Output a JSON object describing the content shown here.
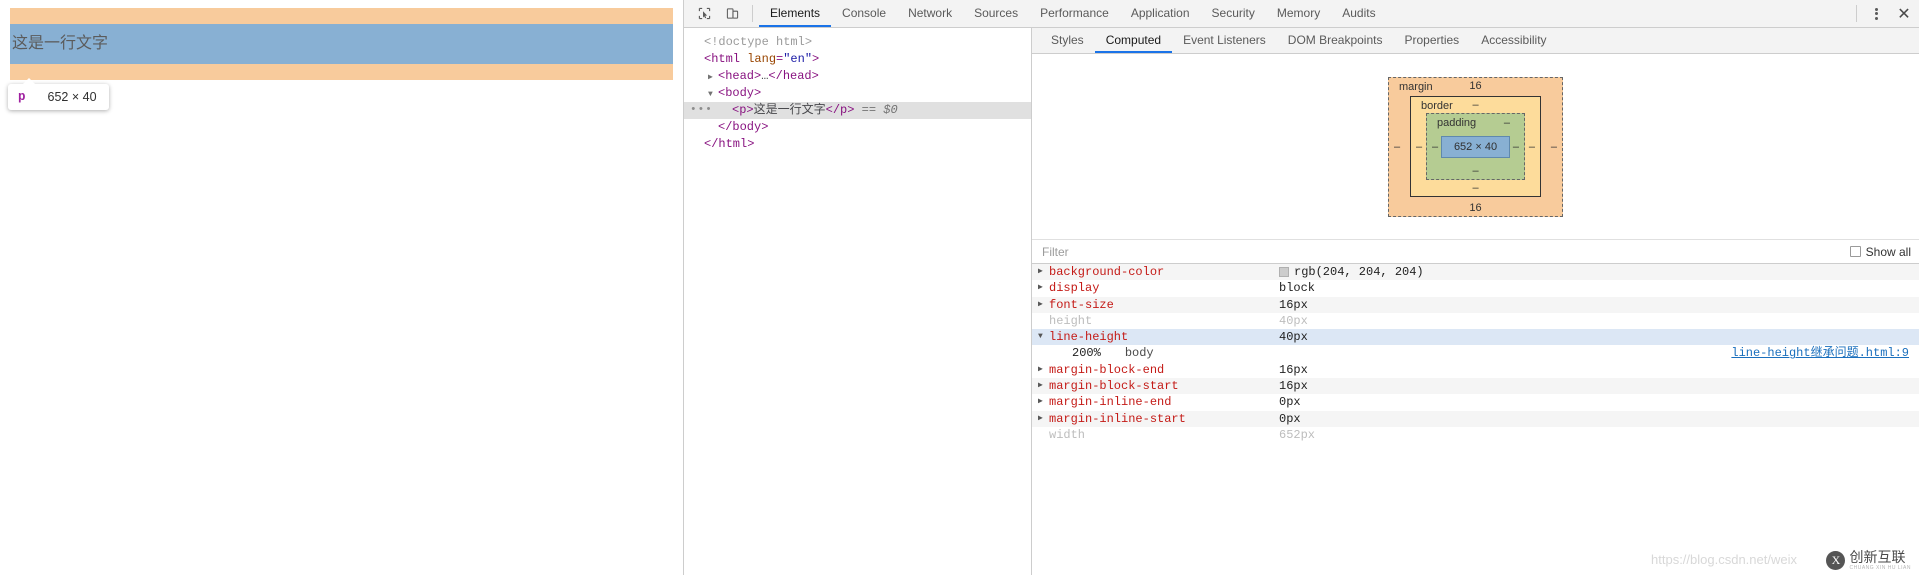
{
  "webpage": {
    "paragraph_text": "这是一行文字",
    "inspect_tooltip": {
      "tag": "p",
      "dimensions": "652 × 40"
    }
  },
  "devtools": {
    "toolbar": {
      "inspect_icon": "cursor-select-icon",
      "device_icon": "device-toolbar-icon",
      "tabs": [
        {
          "label": "Elements",
          "active": true
        },
        {
          "label": "Console",
          "active": false
        },
        {
          "label": "Network",
          "active": false
        },
        {
          "label": "Sources",
          "active": false
        },
        {
          "label": "Performance",
          "active": false
        },
        {
          "label": "Application",
          "active": false
        },
        {
          "label": "Security",
          "active": false
        },
        {
          "label": "Memory",
          "active": false
        },
        {
          "label": "Audits",
          "active": false
        }
      ],
      "more_icon": "kebab-menu-icon",
      "close_icon": "close-icon",
      "close_label": "✕"
    },
    "dom_tree": [
      {
        "indent": 0,
        "twisty": "",
        "badge": false,
        "selected": false,
        "parts": [
          {
            "cls": "dt-doctype",
            "t": "<!doctype html>"
          }
        ]
      },
      {
        "indent": 0,
        "twisty": "",
        "badge": false,
        "selected": false,
        "parts": [
          {
            "cls": "tw",
            "t": "<html "
          },
          {
            "cls": "at",
            "t": "lang"
          },
          {
            "cls": "tw",
            "t": "="
          },
          {
            "cls": "av",
            "t": "\"en\""
          },
          {
            "cls": "tw",
            "t": ">"
          }
        ]
      },
      {
        "indent": 1,
        "twisty": "▶",
        "badge": false,
        "selected": false,
        "parts": [
          {
            "cls": "tw",
            "t": "<head>"
          },
          {
            "cls": "txt",
            "t": "…"
          },
          {
            "cls": "tw",
            "t": "</head>"
          }
        ]
      },
      {
        "indent": 1,
        "twisty": "▼",
        "badge": false,
        "selected": false,
        "parts": [
          {
            "cls": "tw",
            "t": "<body>"
          }
        ]
      },
      {
        "indent": 2,
        "twisty": "",
        "badge": true,
        "selected": true,
        "parts": [
          {
            "cls": "tw",
            "t": "<p>"
          },
          {
            "cls": "txt",
            "t": "这是一行文字"
          },
          {
            "cls": "tw",
            "t": "</p>"
          },
          {
            "cls": "dollar",
            "t": " == $0"
          }
        ]
      },
      {
        "indent": 1,
        "twisty": "",
        "badge": false,
        "selected": false,
        "parts": [
          {
            "cls": "tw",
            "t": "</body>"
          }
        ]
      },
      {
        "indent": 0,
        "twisty": "",
        "badge": false,
        "selected": false,
        "parts": [
          {
            "cls": "tw",
            "t": "</html>"
          }
        ]
      }
    ],
    "sidebar_tabs": [
      {
        "label": "Styles",
        "active": false
      },
      {
        "label": "Computed",
        "active": true
      },
      {
        "label": "Event Listeners",
        "active": false
      },
      {
        "label": "DOM Breakpoints",
        "active": false
      },
      {
        "label": "Properties",
        "active": false
      },
      {
        "label": "Accessibility",
        "active": false
      }
    ],
    "box_model": {
      "margin_label": "margin",
      "margin_top": "16",
      "margin_bottom": "16",
      "margin_left": "–",
      "margin_right": "–",
      "border_label": "border",
      "border_top": "–",
      "border_bottom": "–",
      "border_left": "–",
      "border_right": "–",
      "padding_label": "padding",
      "padding_top": "–",
      "padding_bottom": "–",
      "padding_left": "–",
      "padding_right": "–",
      "content": "652 × 40",
      "colors": {
        "margin": "#f8cb9c",
        "border": "#fddc9b",
        "padding": "#b5cc92",
        "content": "#88b0d3"
      }
    },
    "filter": {
      "placeholder": "Filter",
      "value": "",
      "show_all_label": "Show all",
      "show_all_checked": false
    },
    "computed_properties": [
      {
        "name": "background-color",
        "value": "rgb(204, 204, 204)",
        "arrow": "▶",
        "swatch": "#cccccc",
        "inherited": false,
        "selected": false
      },
      {
        "name": "display",
        "value": "block",
        "arrow": "▶",
        "swatch": null,
        "inherited": false,
        "selected": false
      },
      {
        "name": "font-size",
        "value": "16px",
        "arrow": "▶",
        "swatch": null,
        "inherited": false,
        "selected": false
      },
      {
        "name": "height",
        "value": "40px",
        "arrow": "",
        "swatch": null,
        "inherited": true,
        "selected": false
      },
      {
        "name": "line-height",
        "value": "40px",
        "arrow": "▼",
        "swatch": null,
        "inherited": false,
        "selected": true,
        "sub": {
          "percent": "200%",
          "selector": "body",
          "link": "line-height继承问题.html:9"
        }
      },
      {
        "name": "margin-block-end",
        "value": "16px",
        "arrow": "▶",
        "swatch": null,
        "inherited": false,
        "selected": false
      },
      {
        "name": "margin-block-start",
        "value": "16px",
        "arrow": "▶",
        "swatch": null,
        "inherited": false,
        "selected": false
      },
      {
        "name": "margin-inline-end",
        "value": "0px",
        "arrow": "▶",
        "swatch": null,
        "inherited": false,
        "selected": false
      },
      {
        "name": "margin-inline-start",
        "value": "0px",
        "arrow": "▶",
        "swatch": null,
        "inherited": false,
        "selected": false
      },
      {
        "name": "width",
        "value": "652px",
        "arrow": "",
        "swatch": null,
        "inherited": true,
        "selected": false
      }
    ]
  },
  "watermark": {
    "url": "https://blog.csdn.net/weix",
    "brand_mark": "X",
    "brand_main": "创新互联",
    "brand_sub": "CHUANG XIN HU LIAN"
  }
}
